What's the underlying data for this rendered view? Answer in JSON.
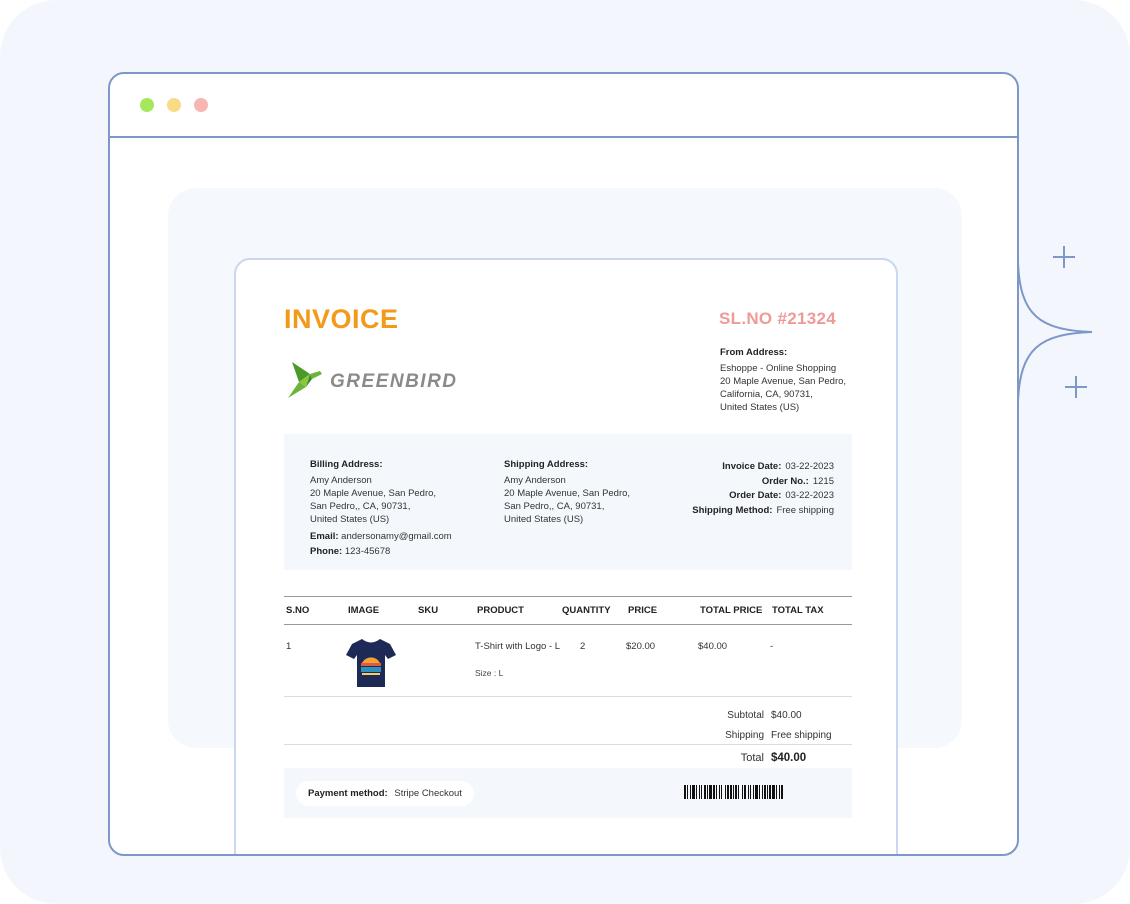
{
  "invoice": {
    "title": "INVOICE",
    "serial": "SL.NO #21324",
    "brand": "GREENBIRD"
  },
  "from_address": {
    "label": "From Address:",
    "lines": [
      "Eshoppe - Online Shopping",
      "20 Maple Avenue, San Pedro,",
      "California, CA, 90731,",
      "United States (US)"
    ]
  },
  "billing": {
    "label": "Billing Address:",
    "lines": [
      "Amy Anderson",
      "20 Maple Avenue, San Pedro,",
      "San Pedro,, CA, 90731,",
      "United States (US)"
    ],
    "email_label": "Email:",
    "email": "andersonamy@gmail.com",
    "phone_label": "Phone:",
    "phone": "123-45678"
  },
  "shipping": {
    "label": "Shipping Address:",
    "lines": [
      "Amy Anderson",
      "20 Maple Avenue, San Pedro,",
      "San Pedro,, CA, 90731,",
      "United States (US)"
    ]
  },
  "meta": [
    {
      "label": "Invoice Date:",
      "value": "03-22-2023"
    },
    {
      "label": "Order No.:",
      "value": "1215"
    },
    {
      "label": "Order Date:",
      "value": "03-22-2023"
    },
    {
      "label": "Shipping Method:",
      "value": "Free shipping"
    }
  ],
  "table": {
    "headers": [
      "S.NO",
      "IMAGE",
      "SKU",
      "PRODUCT",
      "QUANTITY",
      "PRICE",
      "TOTAL PRICE",
      "TOTAL TAX"
    ],
    "rows": [
      {
        "sno": "1",
        "image_icon": "tshirt-alaska-image",
        "sku": "",
        "product": "T-Shirt with Logo - L",
        "size_note": "Size : L",
        "quantity": "2",
        "price": "$20.00",
        "total_price": "$40.00",
        "total_tax": "-"
      }
    ]
  },
  "totals": {
    "subtotal_label": "Subtotal",
    "subtotal": "$40.00",
    "shipping_label": "Shipping",
    "shipping": "Free shipping",
    "total_label": "Total",
    "total": "$40.00"
  },
  "payment": {
    "label": "Payment method:",
    "value": "Stripe Checkout"
  },
  "colors": {
    "accent_orange": "#f39a1a",
    "serial_pink": "#f09a97",
    "frame_blue": "#7e97c9"
  }
}
